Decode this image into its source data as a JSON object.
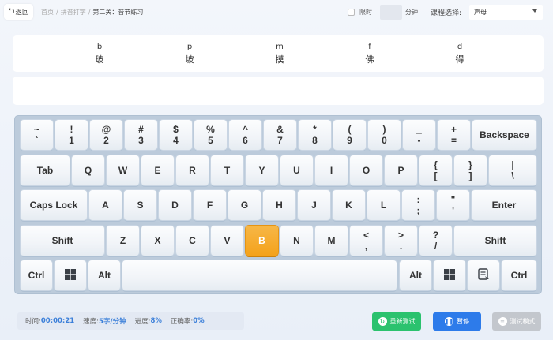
{
  "topbar": {
    "back_label": "返回",
    "breadcrumb": [
      "首页",
      "拼音打字",
      "第二关：音节练习"
    ],
    "timed_label": "限时",
    "minutes_value": "",
    "minutes_unit": "分钟",
    "course_label": "课程选择:",
    "course_selected": "声母"
  },
  "syllables": [
    {
      "pinyin": "b",
      "hanzi": "玻"
    },
    {
      "pinyin": "p",
      "hanzi": "坡"
    },
    {
      "pinyin": "m",
      "hanzi": "摸"
    },
    {
      "pinyin": "f",
      "hanzi": "佛"
    },
    {
      "pinyin": "d",
      "hanzi": "得"
    }
  ],
  "input": {
    "value": ""
  },
  "keyboard": {
    "active_key": "B",
    "row1": [
      {
        "top": "~",
        "bottom": "`"
      },
      {
        "top": "!",
        "bottom": "1"
      },
      {
        "top": "@",
        "bottom": "2"
      },
      {
        "top": "#",
        "bottom": "3"
      },
      {
        "top": "$",
        "bottom": "4"
      },
      {
        "top": "%",
        "bottom": "5"
      },
      {
        "top": "^",
        "bottom": "6"
      },
      {
        "top": "&",
        "bottom": "7"
      },
      {
        "top": "*",
        "bottom": "8"
      },
      {
        "top": "(",
        "bottom": "9"
      },
      {
        "top": ")",
        "bottom": "0"
      },
      {
        "top": "_",
        "bottom": "-"
      },
      {
        "top": "+",
        "bottom": "="
      },
      {
        "label": "Backspace"
      }
    ],
    "row2": [
      {
        "label": "Tab"
      },
      {
        "label": "Q"
      },
      {
        "label": "W"
      },
      {
        "label": "E"
      },
      {
        "label": "R"
      },
      {
        "label": "T"
      },
      {
        "label": "Y"
      },
      {
        "label": "U"
      },
      {
        "label": "I"
      },
      {
        "label": "O"
      },
      {
        "label": "P"
      },
      {
        "top": "{",
        "bottom": "["
      },
      {
        "top": "}",
        "bottom": "]"
      },
      {
        "top": "|",
        "bottom": "\\"
      }
    ],
    "row3": [
      {
        "label": "Caps Lock"
      },
      {
        "label": "A"
      },
      {
        "label": "S"
      },
      {
        "label": "D"
      },
      {
        "label": "F"
      },
      {
        "label": "G"
      },
      {
        "label": "H"
      },
      {
        "label": "J"
      },
      {
        "label": "K"
      },
      {
        "label": "L"
      },
      {
        "top": ":",
        "bottom": ";"
      },
      {
        "top": "\"",
        "bottom": "'"
      },
      {
        "label": "Enter"
      }
    ],
    "row4": [
      {
        "label": "Shift"
      },
      {
        "label": "Z"
      },
      {
        "label": "X"
      },
      {
        "label": "C"
      },
      {
        "label": "V"
      },
      {
        "label": "B"
      },
      {
        "label": "N"
      },
      {
        "label": "M"
      },
      {
        "top": "<",
        "bottom": ","
      },
      {
        "top": ">",
        "bottom": "."
      },
      {
        "top": "?",
        "bottom": "/"
      },
      {
        "label": "Shift"
      }
    ],
    "row5": [
      {
        "label": "Ctrl"
      },
      {
        "icon": "windows-icon"
      },
      {
        "label": "Alt"
      },
      {
        "label": ""
      },
      {
        "label": "Alt"
      },
      {
        "icon": "windows-icon"
      },
      {
        "icon": "menu-icon"
      },
      {
        "label": "Ctrl"
      }
    ]
  },
  "stats": {
    "time_label": "时间:",
    "time_value": "00:00:21",
    "speed_label": "速度:",
    "speed_value": "5字/分钟",
    "progress_label": "进度:",
    "progress_value": "8%",
    "accuracy_label": "正确率:",
    "accuracy_value": "0%"
  },
  "actions": {
    "restart_label": "重新测试",
    "pause_label": "暂停",
    "test_mode_label": "测试模式"
  },
  "colors": {
    "active_key": "#f4a21b",
    "restart": "#2bc26e",
    "pause": "#2d7bea",
    "test_mode": "#c3c7cd",
    "stat_value": "#3b7fd9"
  }
}
